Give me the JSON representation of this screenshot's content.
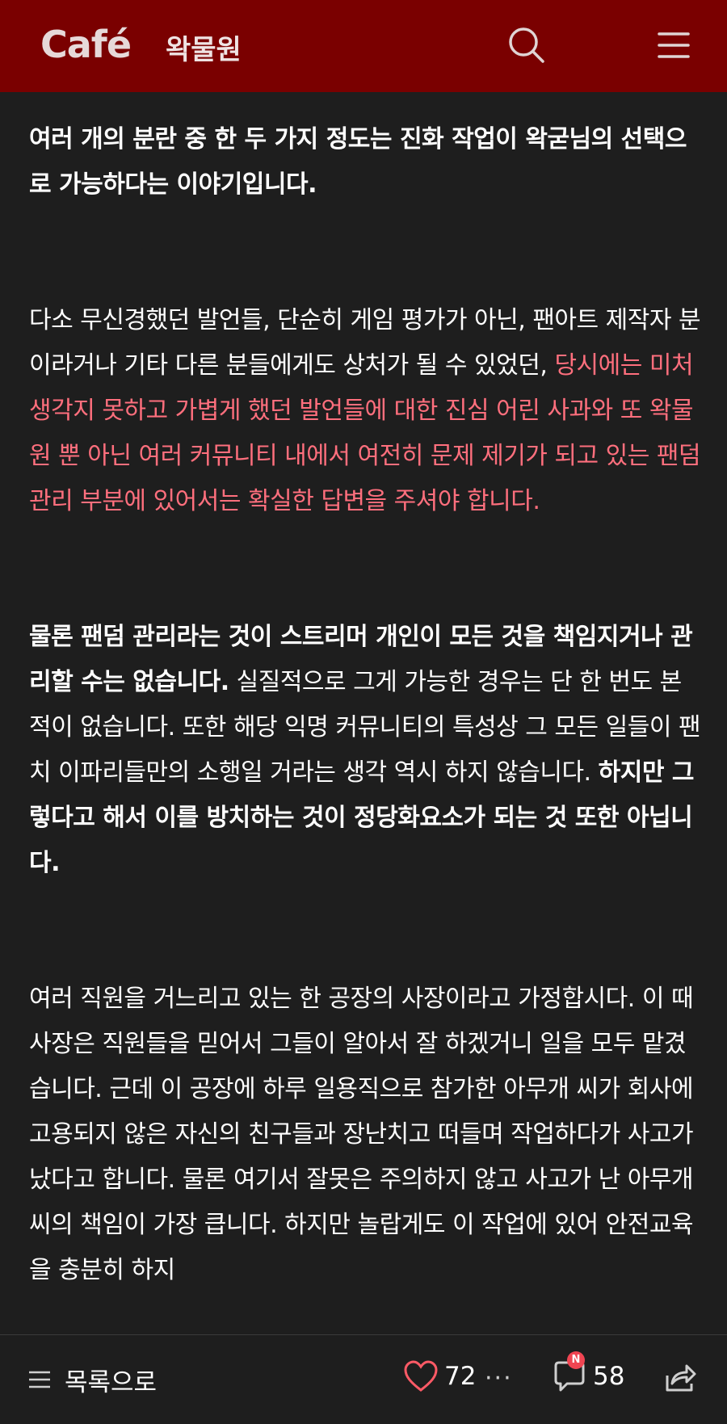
{
  "header": {
    "logo": "Café",
    "cafe_name": "왁물원",
    "search_icon": "search-icon",
    "menu_icon": "hamburger-menu-icon",
    "background": "#7a0000"
  },
  "article": {
    "p1": {
      "bold": "여러 개의 분란 중 한 두 가지 정도는 진화 작업이 왁굳님의 선택으로 가능하다는 이야기입니다."
    },
    "p2": {
      "normal": "다소 무신경했던 발언들, 단순히 게임 평가가 아닌, 팬아트 제작자 분이라거나 기타 다른 분들에게도 상처가 될 수 있었던, ",
      "pink": "당시에는 미처 생각지 못하고 가볍게 했던 발언들에 대한 진심 어린 사과와 또 왁물원 뿐 아닌 여러 커뮤니티 내에서 여전히 문제 제기가 되고 있는 팬덤 관리 부분에 있어서는 확실한 답변을 주셔야 합니다."
    },
    "p3": {
      "bold1": "물론 팬덤 관리라는 것이 스트리머 개인이 모든 것을 책임지거나 관리할 수는 없습니다.",
      "normal": " 실질적으로 그게 가능한 경우는 단 한 번도 본 적이 없습니다. 또한 해당 익명 커뮤니티의 특성상 그 모든 일들이 팬치 이파리들만의 소행일 거라는 생각 역시 하지 않습니다. ",
      "bold2": "하지만 그렇다고 해서 이를 방치하는 것이 정당화요소가 되는 것 또한 아닙니다."
    },
    "p4": {
      "normal": "여러 직원을 거느리고 있는 한 공장의 사장이라고 가정합시다. 이 때 사장은 직원들을 믿어서 그들이 알아서 잘 하겠거니 일을 모두 맡겼습니다. 근데 이 공장에 하루 일용직으로 참가한 아무개 씨가 회사에 고용되지 않은 자신의 친구들과 장난치고 떠들며 작업하다가 사고가 났다고 합니다. 물론 여기서 잘못은 주의하지 않고 사고가 난 아무개 씨의 책임이 가장 큽니다. 하지만 놀랍게도 이 작업에 있어 안전교육을 충분히 하지"
    },
    "pink_color": "#ff6f7d"
  },
  "bottom_bar": {
    "list_label": "목록으로",
    "like_count": "72",
    "more": "···",
    "new_badge": "N",
    "comment_count": "58",
    "like_icon": "heart-icon",
    "comment_icon": "comment-icon",
    "share_icon": "share-icon"
  }
}
